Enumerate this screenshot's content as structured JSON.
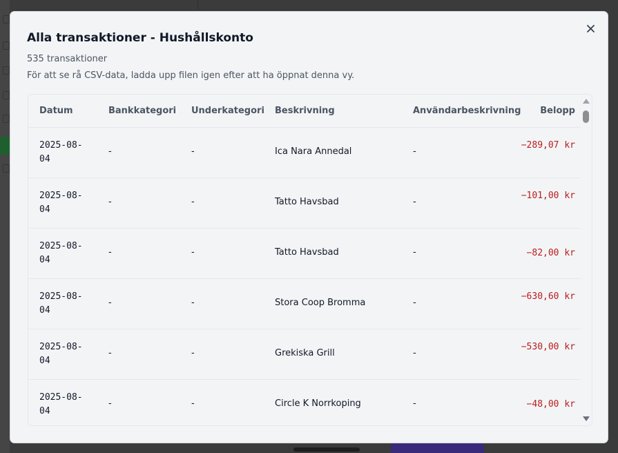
{
  "modal": {
    "title": "Alla transaktioner - Hushållskonto",
    "count": "535 transaktioner",
    "hint": "För att se rå CSV-data, ladda upp filen igen efter att ha öppnat denna vy.",
    "close_icon": "close-icon"
  },
  "table": {
    "headers": {
      "date": "Datum",
      "bank_category": "Bankkategori",
      "subcategory": "Underkategori",
      "description": "Beskrivning",
      "user_description": "Användarbeskrivning",
      "amount": "Belopp"
    },
    "rows": [
      {
        "date": "2025-08-04",
        "bank_category": "-",
        "subcategory": "-",
        "description": "Ica Nara Annedal",
        "user_description": "-",
        "amount": "−289,07 kr"
      },
      {
        "date": "2025-08-04",
        "bank_category": "-",
        "subcategory": "-",
        "description": "Tatto Havsbad",
        "user_description": "-",
        "amount": "−101,00 kr"
      },
      {
        "date": "2025-08-04",
        "bank_category": "-",
        "subcategory": "-",
        "description": "Tatto Havsbad",
        "user_description": "-",
        "amount": "−82,00 kr"
      },
      {
        "date": "2025-08-04",
        "bank_category": "-",
        "subcategory": "-",
        "description": "Stora Coop Bromma",
        "user_description": "-",
        "amount": "−630,60 kr"
      },
      {
        "date": "2025-08-04",
        "bank_category": "-",
        "subcategory": "-",
        "description": "Grekiska Grill",
        "user_description": "-",
        "amount": "−530,00 kr"
      },
      {
        "date": "2025-08-04",
        "bank_category": "-",
        "subcategory": "-",
        "description": "Circle K Norrkoping",
        "user_description": "-",
        "amount": "−48,00 kr"
      }
    ]
  },
  "colors": {
    "negative_amount": "#b91c1c",
    "modal_background": "#f3f4f6",
    "backdrop": "#3b3b3b"
  }
}
